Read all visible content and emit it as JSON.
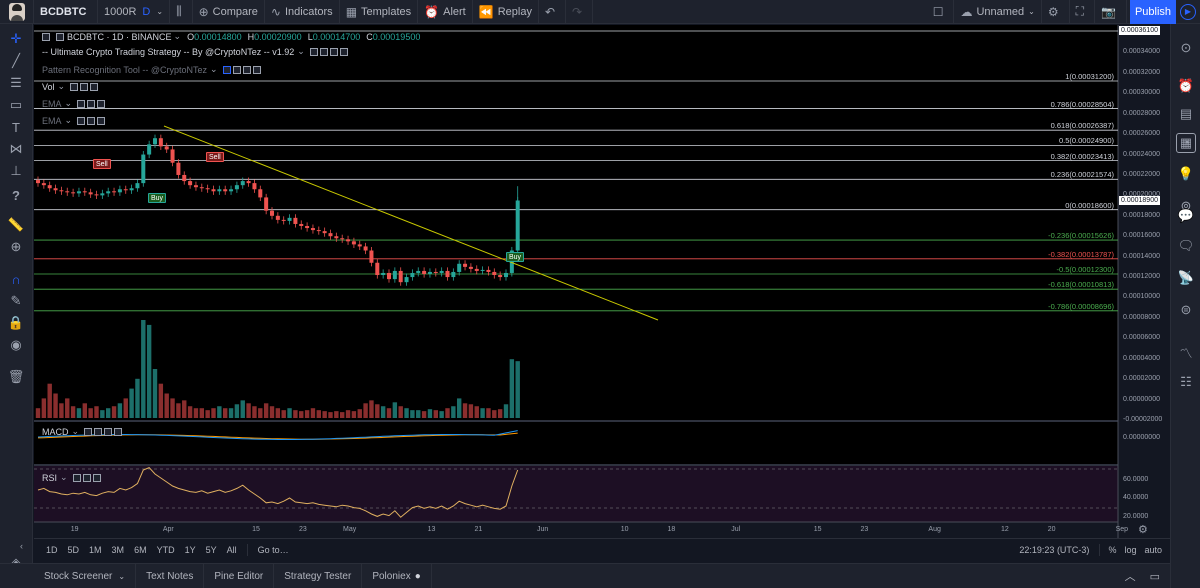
{
  "toolbar": {
    "symbol": "BCDBTC",
    "interval": "1000R",
    "chart_style": "D",
    "compare": "Compare",
    "indicators": "Indicators",
    "templates": "Templates",
    "alert": "Alert",
    "replay": "Replay",
    "layout_name": "Unnamed",
    "publish": "Publish"
  },
  "legend": {
    "title": "BCDBTC · 1D · BINANCE",
    "o_label": "O",
    "o_value": "0.00014800",
    "h_label": "H",
    "h_value": "0.00020900",
    "l_label": "L",
    "l_value": "0.00014700",
    "c_label": "C",
    "c_value": "0.00019500",
    "strategy": "-- Ultimate Crypto Trading Strategy -- By @CryptoNTez -- v1.92",
    "pattern": "Pattern Recognition Tool -- @CryptoNTez",
    "vol": "Vol",
    "ema1": "EMA",
    "ema2": "EMA",
    "macd": "MACD",
    "rsi": "RSI"
  },
  "fib_levels": [
    {
      "label": "1(0.00031200)",
      "price": 0.000312,
      "color": "#d1d4dc"
    },
    {
      "label": "0.786(0.00028504)",
      "price": 0.00028504,
      "color": "#d1d4dc"
    },
    {
      "label": "0.618(0.00026387)",
      "price": 0.00026387,
      "color": "#d1d4dc"
    },
    {
      "label": "0.5(0.00024900)",
      "price": 0.000249,
      "color": "#d1d4dc"
    },
    {
      "label": "0.382(0.00023413)",
      "price": 0.00023413,
      "color": "#d1d4dc"
    },
    {
      "label": "0.236(0.00021574)",
      "price": 0.00021574,
      "color": "#d1d4dc"
    },
    {
      "label": "0(0.00018600)",
      "price": 0.000186,
      "color": "#d1d4dc"
    },
    {
      "label": "-0.236(0.00015626)",
      "price": 0.00015626,
      "color": "#4caf50"
    },
    {
      "label": "-0.382(0.00013787)",
      "price": 0.00013787,
      "color": "#ef5350"
    },
    {
      "label": "-0.5(0.00012300)",
      "price": 0.000123,
      "color": "#4caf50"
    },
    {
      "label": "-0.618(0.00010813)",
      "price": 0.00010813,
      "color": "#4caf50"
    },
    {
      "label": "-0.786(0.00008696)",
      "price": 8.696e-05,
      "color": "#4caf50"
    }
  ],
  "price_axis": [
    "0.00036100",
    "0.00034000",
    "0.00032000",
    "0.00030000",
    "0.00028000",
    "0.00026000",
    "0.00024000",
    "0.00022000",
    "0.00020000",
    "0.00018000",
    "0.00016000",
    "0.00014000",
    "0.00012000",
    "0.00010000",
    "0.00008000",
    "0.00006000",
    "0.00004000",
    "0.00002000",
    "0.00000000",
    "-0.00002000"
  ],
  "current_price": "0.00018900",
  "macd_axis": [
    "0.00000000"
  ],
  "rsi_axis": [
    "60.0000",
    "40.0000",
    "20.0000"
  ],
  "time_axis": [
    "19",
    "Apr",
    "15",
    "23",
    "May",
    "13",
    "21",
    "Jun",
    "10",
    "18",
    "Jul",
    "15",
    "23",
    "Aug",
    "12",
    "20",
    "Sep"
  ],
  "signals": [
    {
      "label": "Sell",
      "color": "#ef5350"
    },
    {
      "label": "Sell",
      "color": "#ef5350"
    },
    {
      "label": "Buy",
      "color": "#26a69a"
    },
    {
      "label": "Buy",
      "color": "#26a69a"
    }
  ],
  "ranges": [
    "1D",
    "5D",
    "1M",
    "3M",
    "6M",
    "YTD",
    "1Y",
    "5Y",
    "All"
  ],
  "goto": "Go to…",
  "clock": "22:19:23 (UTC-3)",
  "scale_options": [
    "%",
    "log",
    "auto"
  ],
  "bottom_tabs": [
    "Stock Screener",
    "Text Notes",
    "Pine Editor",
    "Strategy Tester",
    "Poloniex"
  ],
  "colors": {
    "up": "#26a69a",
    "down": "#ef5350",
    "trendline": "#c8c800",
    "accent": "#2962ff",
    "macd": "#2196f3",
    "signal": "#ff9800",
    "rsi": "#e0b060"
  },
  "chart_data": {
    "type": "candlestick",
    "title": "BCDBTC · 1D · BINANCE",
    "ylim": [
      -2e-05,
      0.000361
    ],
    "close_values": [
      0.000212,
      0.00021,
      0.000207,
      0.000205,
      0.000204,
      0.000203,
      0.000202,
      0.000204,
      0.000203,
      0.000201,
      0.0002,
      0.000202,
      0.000204,
      0.000203,
      0.000206,
      0.000205,
      0.000207,
      0.000212,
      0.00024,
      0.00025,
      0.000256,
      0.000248,
      0.000245,
      0.000232,
      0.00022,
      0.000214,
      0.00021,
      0.000208,
      0.000207,
      0.000206,
      0.000204,
      0.000206,
      0.000204,
      0.000206,
      0.00021,
      0.000214,
      0.000212,
      0.000206,
      0.000198,
      0.000185,
      0.00018,
      0.000176,
      0.000175,
      0.000178,
      0.000172,
      0.00017,
      0.000168,
      0.000166,
      0.000165,
      0.000163,
      0.00016,
      0.000158,
      0.000157,
      0.000155,
      0.000152,
      0.00015,
      0.000146,
      0.000134,
      0.000122,
      0.000124,
      0.000118,
      0.000126,
      0.000115,
      0.00012,
      0.000124,
      0.000126,
      0.000123,
      0.000125,
      0.000124,
      0.000126,
      0.00012,
      0.000125,
      0.000133,
      0.00013,
      0.000128,
      0.000126,
      0.000127,
      0.000125,
      0.000122,
      0.00012,
      0.000124,
      0.000146,
      0.000195
    ],
    "volume_relative": [
      0.1,
      0.2,
      0.35,
      0.25,
      0.15,
      0.2,
      0.12,
      0.1,
      0.15,
      0.1,
      0.12,
      0.08,
      0.1,
      0.12,
      0.15,
      0.2,
      0.3,
      0.4,
      1.0,
      0.95,
      0.5,
      0.35,
      0.25,
      0.2,
      0.15,
      0.18,
      0.12,
      0.1,
      0.1,
      0.08,
      0.1,
      0.12,
      0.1,
      0.1,
      0.14,
      0.18,
      0.15,
      0.12,
      0.1,
      0.15,
      0.12,
      0.1,
      0.08,
      0.1,
      0.08,
      0.07,
      0.08,
      0.1,
      0.08,
      0.07,
      0.06,
      0.07,
      0.06,
      0.08,
      0.07,
      0.09,
      0.15,
      0.18,
      0.14,
      0.12,
      0.1,
      0.16,
      0.12,
      0.1,
      0.08,
      0.08,
      0.07,
      0.09,
      0.08,
      0.07,
      0.1,
      0.12,
      0.2,
      0.15,
      0.14,
      0.12,
      0.1,
      0.1,
      0.08,
      0.09,
      0.14,
      0.6,
      0.58
    ]
  }
}
